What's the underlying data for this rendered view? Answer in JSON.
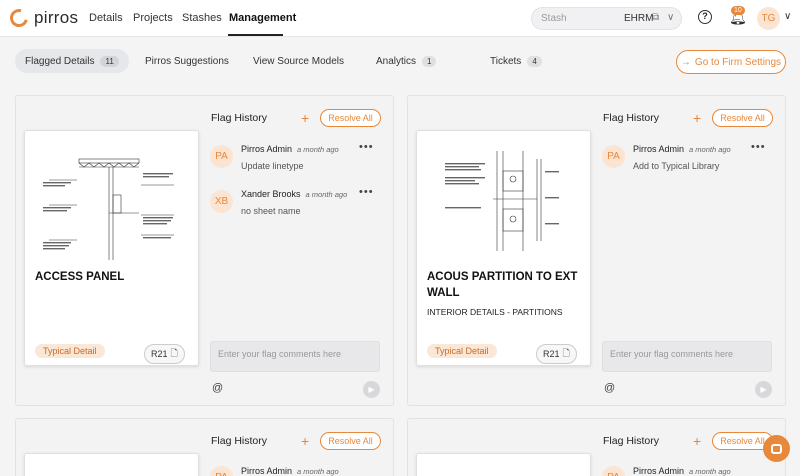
{
  "app": {
    "name": "pirros"
  },
  "nav": {
    "items": [
      {
        "label": "Details",
        "active": false
      },
      {
        "label": "Projects",
        "active": false
      },
      {
        "label": "Stashes",
        "active": false
      },
      {
        "label": "Management",
        "active": true
      }
    ]
  },
  "stash": {
    "placeholder": "Stash",
    "value": "EHRM"
  },
  "notifications": {
    "count": "10"
  },
  "user": {
    "initials": "TG"
  },
  "subtabs": [
    {
      "label": "Flagged Details",
      "count": "11",
      "active": true
    },
    {
      "label": "Pirros Suggestions",
      "count": "",
      "active": false
    },
    {
      "label": "View Source Models",
      "count": "",
      "active": false
    },
    {
      "label": "Analytics",
      "count": "1",
      "active": false
    },
    {
      "label": "Tickets",
      "count": "4",
      "active": false
    }
  ],
  "firm_settings_label": "Go to Firm Settings",
  "cards": [
    {
      "title": "ACCESS PANEL",
      "subtitle": "",
      "type_badge": "Typical Detail",
      "revision": "R21",
      "flag_history_label": "Flag History",
      "resolve_label": "Resolve All",
      "comment_placeholder": "Enter your flag comments here",
      "flags": [
        {
          "initials": "PA",
          "name": "Pirros Admin",
          "time": "a month ago",
          "message": "Update linetype"
        },
        {
          "initials": "XB",
          "name": "Xander Brooks",
          "time": "a month ago",
          "message": "no sheet name"
        }
      ]
    },
    {
      "title": "ACOUS PARTITION TO EXT WALL",
      "subtitle": "INTERIOR DETAILS - PARTITIONS",
      "type_badge": "Typical Detail",
      "revision": "R21",
      "flag_history_label": "Flag History",
      "resolve_label": "Resolve All",
      "comment_placeholder": "Enter your flag comments here",
      "flags": [
        {
          "initials": "PA",
          "name": "Pirros Admin",
          "time": "a month ago",
          "message": "Add to Typical Library"
        }
      ]
    },
    {
      "flag_history_label": "Flag History",
      "resolve_label": "Resolve All",
      "flags": [
        {
          "initials": "PA",
          "name": "Pirros Admin",
          "time": "a month ago"
        }
      ]
    },
    {
      "flag_history_label": "Flag History",
      "resolve_label": "Resolve All",
      "flags": [
        {
          "initials": "PA",
          "name": "Pirros Admin",
          "time": "a month ago"
        }
      ]
    }
  ],
  "colors": {
    "accent": "#e8883a",
    "accent_light": "#fbe4d2",
    "background": "#f4f4f5"
  }
}
